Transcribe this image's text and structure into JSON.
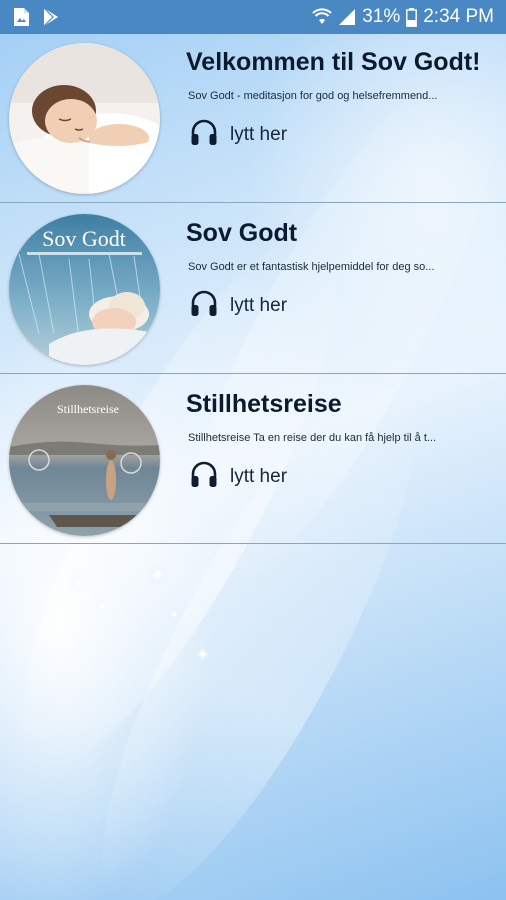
{
  "status_bar": {
    "battery": "31%",
    "time": "2:34 PM",
    "icons": [
      "gallery-icon",
      "play-store-icon",
      "wifi-icon",
      "signal-icon",
      "battery-icon"
    ]
  },
  "colors": {
    "status_bar": "#4a88c4",
    "title_text": "#0b1a2e",
    "divider": "#8aa6bf"
  },
  "items": [
    {
      "title": "Velkommen til Sov Godt!",
      "description": "Sov Godt - meditasjon for god og helsefremmend...",
      "action_label": "lytt her",
      "thumbnail_text": []
    },
    {
      "title": "Sov Godt",
      "description": "Sov Godt er et fantastisk hjelpemiddel for deg so...",
      "action_label": "lytt her",
      "thumbnail_text": [
        "Sov Godt"
      ]
    },
    {
      "title": "Stillhetsreise",
      "description": "Stillhetsreise Ta en reise der du kan få hjelp til å t...",
      "action_label": "lytt her",
      "thumbnail_text": [
        "Stillhetsreise"
      ]
    }
  ]
}
